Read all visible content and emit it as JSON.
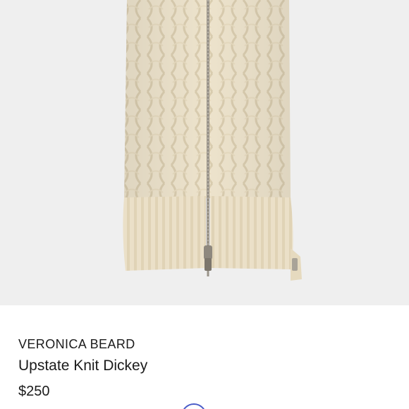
{
  "product": {
    "brand": "VERONICA BEARD",
    "title": "Upstate Knit Dickey",
    "price": "$250"
  },
  "colors": {
    "background": "#ffffff",
    "image_background": "#efefef",
    "knit": "#ede3cc",
    "zipper": "#9a948a",
    "text": "#1b1b1b",
    "accent": "#4a5cc8"
  },
  "icons": {
    "partial_button": "circle-button-icon"
  }
}
